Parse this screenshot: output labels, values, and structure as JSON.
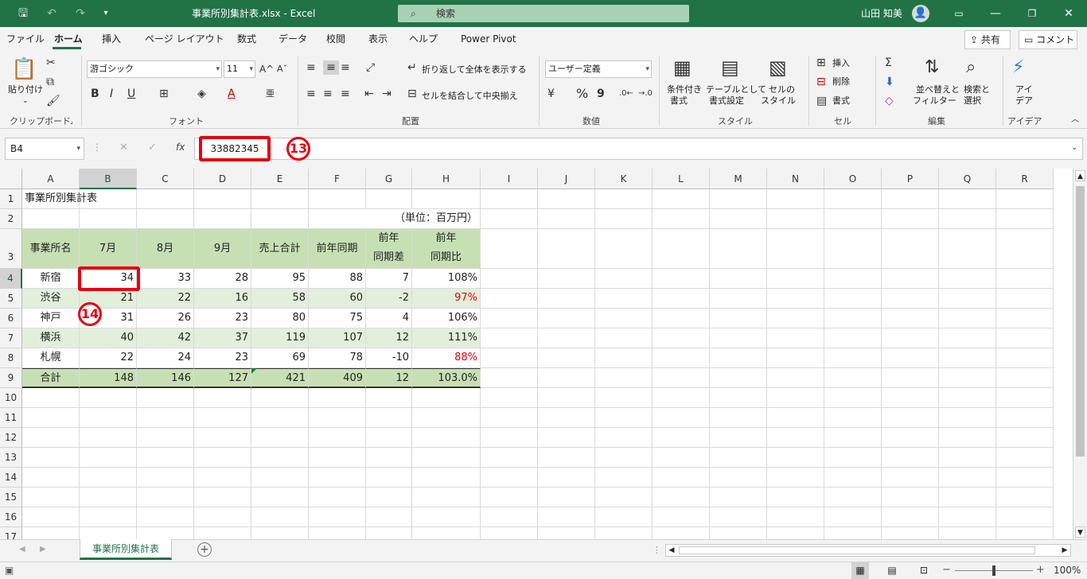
{
  "titlebar": {
    "save_icon": "save-icon",
    "undo_icon": "undo-icon",
    "redo_icon": "redo-icon",
    "title": "事業所別集計表.xlsx  -  Excel",
    "search_placeholder": "検索",
    "user_name": "山田 知美",
    "ribbon_display_icon": "ribbon-display-icon",
    "minimize_icon": "minimize-icon",
    "restore_icon": "restore-icon",
    "close_icon": "close-icon"
  },
  "menu": {
    "tabs": [
      "ファイル",
      "ホーム",
      "挿入",
      "ページ レイアウト",
      "数式",
      "データ",
      "校閲",
      "表示",
      "ヘルプ",
      "Power Pivot"
    ],
    "active_tab": "ホーム",
    "share": "共有",
    "comment": "コメント"
  },
  "ribbon": {
    "clipboard": {
      "paste": "貼り付け",
      "label": "クリップボード"
    },
    "font": {
      "font_name": "游ゴシック",
      "font_size": "11",
      "bold": "B",
      "italic": "I",
      "underline": "U",
      "label": "フォント"
    },
    "alignment": {
      "wrap_text": "折り返して全体を表示する",
      "merge_center": "セルを結合して中央揃え",
      "label": "配置"
    },
    "number": {
      "format": "ユーザー定義",
      "percent": "%",
      "comma": "9",
      "label": "数値"
    },
    "styles": {
      "conditional": "条件付き\n書式",
      "conditional_1": "条件付き",
      "conditional_2": "書式",
      "table_1": "テーブルとして",
      "table_2": "書式設定",
      "cell_style_1": "セルの",
      "cell_style_2": "スタイル",
      "label": "スタイル"
    },
    "cells": {
      "insert": "挿入",
      "delete": "削除",
      "format": "書式",
      "label": "セル"
    },
    "editing": {
      "sort_1": "並べ替えと",
      "sort_2": "フィルター",
      "find_1": "検索と",
      "find_2": "選択",
      "label": "編集"
    },
    "ideas": {
      "ideas_1": "アイ",
      "ideas_2": "デア",
      "label": "アイデア"
    }
  },
  "formula_bar": {
    "name_box": "B4",
    "fx": "fx",
    "value": "33882345"
  },
  "callouts": {
    "c13": "13",
    "c14": "14"
  },
  "columns": [
    "A",
    "B",
    "C",
    "D",
    "E",
    "F",
    "G",
    "H",
    "I",
    "J",
    "K",
    "L",
    "M",
    "N",
    "O",
    "P",
    "Q",
    "R"
  ],
  "rows": [
    "1",
    "2",
    "3",
    "4",
    "5",
    "6",
    "7",
    "8",
    "9",
    "10",
    "11",
    "12",
    "13",
    "14",
    "15",
    "16",
    "17"
  ],
  "sheet": {
    "title": "事業所別集計表",
    "unit": "（単位：百万円）",
    "headers": [
      "事業所名",
      "7月",
      "8月",
      "9月",
      "売上合計",
      "前年同期",
      "前年",
      "同期差",
      "前年",
      "同期比"
    ],
    "data": [
      [
        "新宿",
        "34",
        "33",
        "28",
        "95",
        "88",
        "7",
        "108%"
      ],
      [
        "渋谷",
        "21",
        "22",
        "16",
        "58",
        "60",
        "-2",
        "97%"
      ],
      [
        "神戸",
        "31",
        "26",
        "23",
        "80",
        "75",
        "4",
        "106%"
      ],
      [
        "横浜",
        "40",
        "42",
        "37",
        "119",
        "107",
        "12",
        "111%"
      ],
      [
        "札幌",
        "22",
        "24",
        "23",
        "69",
        "78",
        "-10",
        "88%"
      ]
    ],
    "total": [
      "合計",
      "148",
      "146",
      "127",
      "421",
      "409",
      "12",
      "103.0%"
    ]
  },
  "sheet_tab": "事業所別集計表",
  "status": {
    "zoom": "100%"
  },
  "colors": {
    "excel_green": "#217346",
    "highlight_red": "#e60012",
    "table_header": "#c6e0b4",
    "table_alt": "#e2efda",
    "negative_red": "#e60012"
  }
}
